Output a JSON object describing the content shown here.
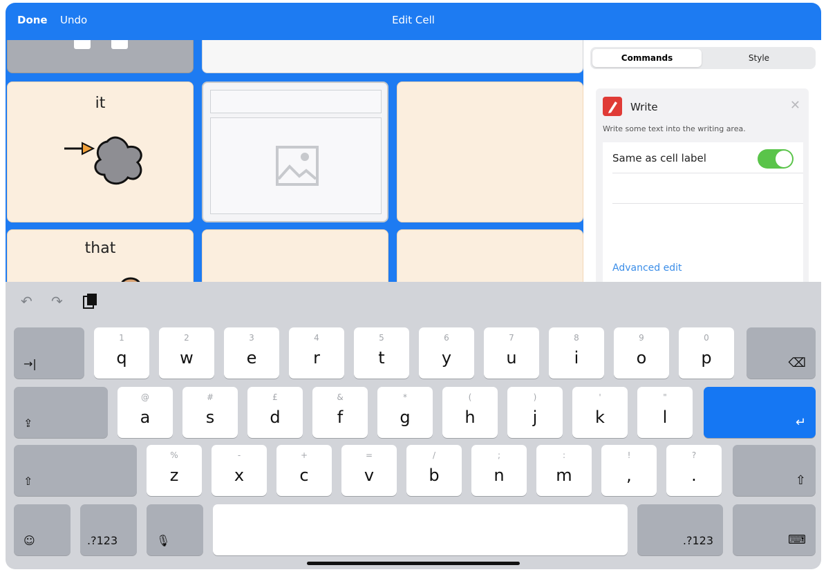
{
  "topbar": {
    "done": "Done",
    "undo": "Undo",
    "title": "Edit Cell"
  },
  "grid": {
    "cells": [
      {
        "label": "it"
      },
      {
        "label": "that"
      }
    ]
  },
  "panel": {
    "tabs": [
      {
        "label": "Commands"
      },
      {
        "label": "Style"
      }
    ],
    "command": {
      "title": "Write",
      "description": "Write some text into the writing area.",
      "option_label": "Same as cell label",
      "advanced_edit": "Advanced edit"
    }
  },
  "keyboard": {
    "row1": [
      {
        "hint": "1",
        "key": "q"
      },
      {
        "hint": "2",
        "key": "w"
      },
      {
        "hint": "3",
        "key": "e"
      },
      {
        "hint": "4",
        "key": "r"
      },
      {
        "hint": "5",
        "key": "t"
      },
      {
        "hint": "6",
        "key": "y"
      },
      {
        "hint": "7",
        "key": "u"
      },
      {
        "hint": "8",
        "key": "i"
      },
      {
        "hint": "9",
        "key": "o"
      },
      {
        "hint": "0",
        "key": "p"
      }
    ],
    "row2": [
      {
        "hint": "@",
        "key": "a"
      },
      {
        "hint": "#",
        "key": "s"
      },
      {
        "hint": "£",
        "key": "d"
      },
      {
        "hint": "&",
        "key": "f"
      },
      {
        "hint": "*",
        "key": "g"
      },
      {
        "hint": "(",
        "key": "h"
      },
      {
        "hint": ")",
        "key": "j"
      },
      {
        "hint": "'",
        "key": "k"
      },
      {
        "hint": "\"",
        "key": "l"
      }
    ],
    "row3": [
      {
        "hint": "%",
        "key": "z"
      },
      {
        "hint": "-",
        "key": "x"
      },
      {
        "hint": "+",
        "key": "c"
      },
      {
        "hint": "=",
        "key": "v"
      },
      {
        "hint": "/",
        "key": "b"
      },
      {
        "hint": ";",
        "key": "n"
      },
      {
        "hint": ":",
        "key": "m"
      },
      {
        "hint": "!",
        "key": ","
      },
      {
        "hint": "?",
        "key": "."
      }
    ],
    "numbers_left": ".?123",
    "numbers_right": ".?123",
    "icons": {
      "tab": "tab-icon",
      "backspace": "backspace-icon",
      "caps": "caps-lock-icon",
      "return": "return-icon",
      "shift": "shift-icon",
      "emoji": "emoji-icon",
      "mic": "microphone-icon",
      "hide": "hide-keyboard-icon",
      "undo": "undo-icon",
      "redo": "redo-icon",
      "clipboard": "clipboard-icon"
    },
    "colors": {
      "accent": "#1d7bf2",
      "return_key": "#1577f3",
      "toggle_on": "#5ac44a"
    }
  }
}
